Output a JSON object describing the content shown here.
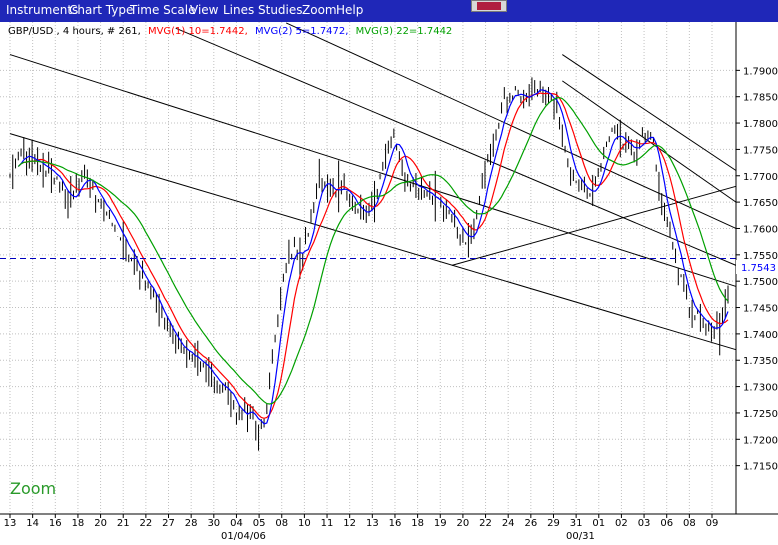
{
  "menu": {
    "items": [
      "Instruments",
      "Chart Type",
      "Time Scale",
      "View",
      "Lines",
      "Studies",
      "Zoom",
      "Help"
    ],
    "background": "#1f27b8",
    "text_color": "#ffffff"
  },
  "chart_data": {
    "type": "line",
    "header": {
      "symbol_text": "GBP/USD , 4 hours, # 261,",
      "mvg1_text": "MVG(1) 10=1.7442,",
      "mvg2_text": "MVG(2) 5=1.7472,",
      "mvg3_text": "MVG(3) 22=1.7442"
    },
    "ylim": [
      1.71,
      1.795
    ],
    "y_ticks": [
      "1.7900",
      "1.7850",
      "1.7800",
      "1.7750",
      "1.7700",
      "1.7650",
      "1.7600",
      "1.7550",
      "1.7500",
      "1.7450",
      "1.7400",
      "1.7350",
      "1.7300",
      "1.7250",
      "1.7200",
      "1.7150"
    ],
    "x_ticks": [
      "13",
      "14",
      "16",
      "18",
      "20",
      "21",
      "22",
      "27",
      "28",
      "30",
      "04",
      "05",
      "08",
      "10",
      "11",
      "12",
      "13",
      "16",
      "18",
      "19",
      "20",
      "22",
      "24",
      "26",
      "29",
      "31",
      "01",
      "02",
      "03",
      "06",
      "08",
      "09"
    ],
    "x_sublabels": [
      "01/04/06",
      "00/31"
    ],
    "current_price": {
      "value": 1.7543,
      "label": "1.7543",
      "color": "#0000ff",
      "line_color": "#0000c0"
    },
    "bar_count": 261,
    "anchors": [
      [
        0,
        1.77
      ],
      [
        4,
        1.774
      ],
      [
        10,
        1.772
      ],
      [
        15,
        1.771
      ],
      [
        21,
        1.765
      ],
      [
        27,
        1.77
      ],
      [
        33,
        1.765
      ],
      [
        40,
        1.758
      ],
      [
        46,
        1.752
      ],
      [
        51,
        1.748
      ],
      [
        56,
        1.742
      ],
      [
        61,
        1.738
      ],
      [
        66,
        1.736
      ],
      [
        71,
        1.733
      ],
      [
        76,
        1.73
      ],
      [
        79,
        1.729
      ],
      [
        83,
        1.724
      ],
      [
        87,
        1.726
      ],
      [
        90,
        1.721
      ],
      [
        93,
        1.725
      ],
      [
        96,
        1.74
      ],
      [
        100,
        1.753
      ],
      [
        103,
        1.757
      ],
      [
        106,
        1.754
      ],
      [
        109,
        1.762
      ],
      [
        112,
        1.77
      ],
      [
        115,
        1.768
      ],
      [
        118,
        1.766
      ],
      [
        121,
        1.768
      ],
      [
        125,
        1.764
      ],
      [
        129,
        1.762
      ],
      [
        132,
        1.766
      ],
      [
        136,
        1.774
      ],
      [
        139,
        1.778
      ],
      [
        142,
        1.772
      ],
      [
        145,
        1.768
      ],
      [
        149,
        1.767
      ],
      [
        153,
        1.766
      ],
      [
        157,
        1.764
      ],
      [
        161,
        1.762
      ],
      [
        165,
        1.757
      ],
      [
        168,
        1.76
      ],
      [
        171,
        1.768
      ],
      [
        175,
        1.776
      ],
      [
        179,
        1.784
      ],
      [
        183,
        1.786
      ],
      [
        187,
        1.784
      ],
      [
        190,
        1.787
      ],
      [
        194,
        1.786
      ],
      [
        198,
        1.783
      ],
      [
        202,
        1.772
      ],
      [
        206,
        1.768
      ],
      [
        210,
        1.766
      ],
      [
        214,
        1.772
      ],
      [
        218,
        1.779
      ],
      [
        222,
        1.776
      ],
      [
        226,
        1.774
      ],
      [
        230,
        1.778
      ],
      [
        233,
        1.776
      ],
      [
        236,
        1.764
      ],
      [
        239,
        1.76
      ],
      [
        242,
        1.752
      ],
      [
        245,
        1.746
      ],
      [
        248,
        1.744
      ],
      [
        251,
        1.742
      ],
      [
        254,
        1.74
      ],
      [
        257,
        1.742
      ],
      [
        260,
        1.7472
      ]
    ],
    "series": [
      {
        "name": "MVG(1) 10",
        "period": 10,
        "color": "#ff0000",
        "last": 1.7442
      },
      {
        "name": "MVG(2) 5",
        "period": 5,
        "color": "#0000ff",
        "last": 1.7472
      },
      {
        "name": "MVG(3) 22",
        "period": 22,
        "color": "#00a000",
        "last": 1.7442
      }
    ],
    "trendlines": [
      {
        "from": [
          0,
          1.778
        ],
        "to": [
          260,
          1.737
        ]
      },
      {
        "from": [
          0,
          1.793
        ],
        "to": [
          260,
          1.749
        ]
      },
      {
        "from": [
          60,
          1.798
        ],
        "to": [
          260,
          1.753
        ]
      },
      {
        "from": [
          100,
          1.799
        ],
        "to": [
          260,
          1.76
        ]
      },
      {
        "from": [
          200,
          1.793
        ],
        "to": [
          260,
          1.771
        ]
      },
      {
        "from": [
          160,
          1.753
        ],
        "to": [
          260,
          1.768
        ]
      },
      {
        "from": [
          200,
          1.788
        ],
        "to": [
          260,
          1.765
        ]
      }
    ],
    "annotation": {
      "text": "Zoom",
      "color": "#2a9a2a"
    },
    "grid": true
  }
}
